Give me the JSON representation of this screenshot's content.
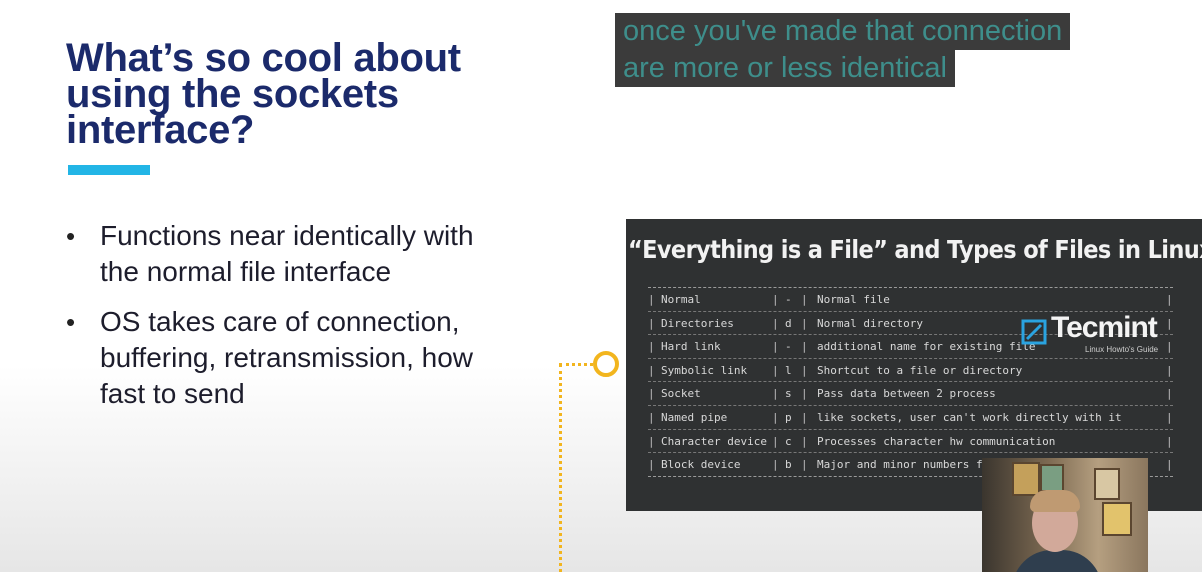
{
  "slide": {
    "title_lines": [
      "What’s so cool about",
      "using the sockets",
      "interface?"
    ],
    "bullets": [
      {
        "lines": [
          "Functions near identically with",
          "the normal file interface"
        ]
      },
      {
        "lines": [
          "OS takes care of connection,",
          "buffering, retransmission, how",
          "fast to send"
        ]
      }
    ],
    "bullet_glyph": "•",
    "accent_color": "#22b5e6",
    "title_color": "#1b2a6b"
  },
  "caption": {
    "lines": [
      "once you've made that connection",
      "are more or less identical"
    ],
    "text_color": "#3e8e8b",
    "background": "#3b3b3b"
  },
  "image": {
    "title": "“Everything is a File” and Types of Files in Linux",
    "rows": [
      {
        "name": "Normal",
        "symbol": "-",
        "desc": "Normal file"
      },
      {
        "name": "Directories",
        "symbol": "d",
        "desc": "Normal directory"
      },
      {
        "name": "Hard link",
        "symbol": "-",
        "desc": "additional name for existing file"
      },
      {
        "name": "Symbolic link",
        "symbol": "l",
        "desc": "Shortcut to a file or directory"
      },
      {
        "name": "Socket",
        "symbol": "s",
        "desc": "Pass data between 2 process"
      },
      {
        "name": "Named pipe",
        "symbol": "p",
        "desc": "like sockets, user can't work directly with it"
      },
      {
        "name": "Character device",
        "symbol": "c",
        "desc": "Processes character hw communication"
      },
      {
        "name": "Block device",
        "symbol": "b",
        "desc": "Major and minor numbers fo"
      }
    ],
    "logo": {
      "text": "Tecmint",
      "tagline": "Linux Howto's Guide",
      "icon": "tecmint-logo-icon"
    }
  },
  "decor": {
    "connector_color": "#f2b51e"
  },
  "webcam": {
    "description": "presenter-webcam-feed"
  }
}
